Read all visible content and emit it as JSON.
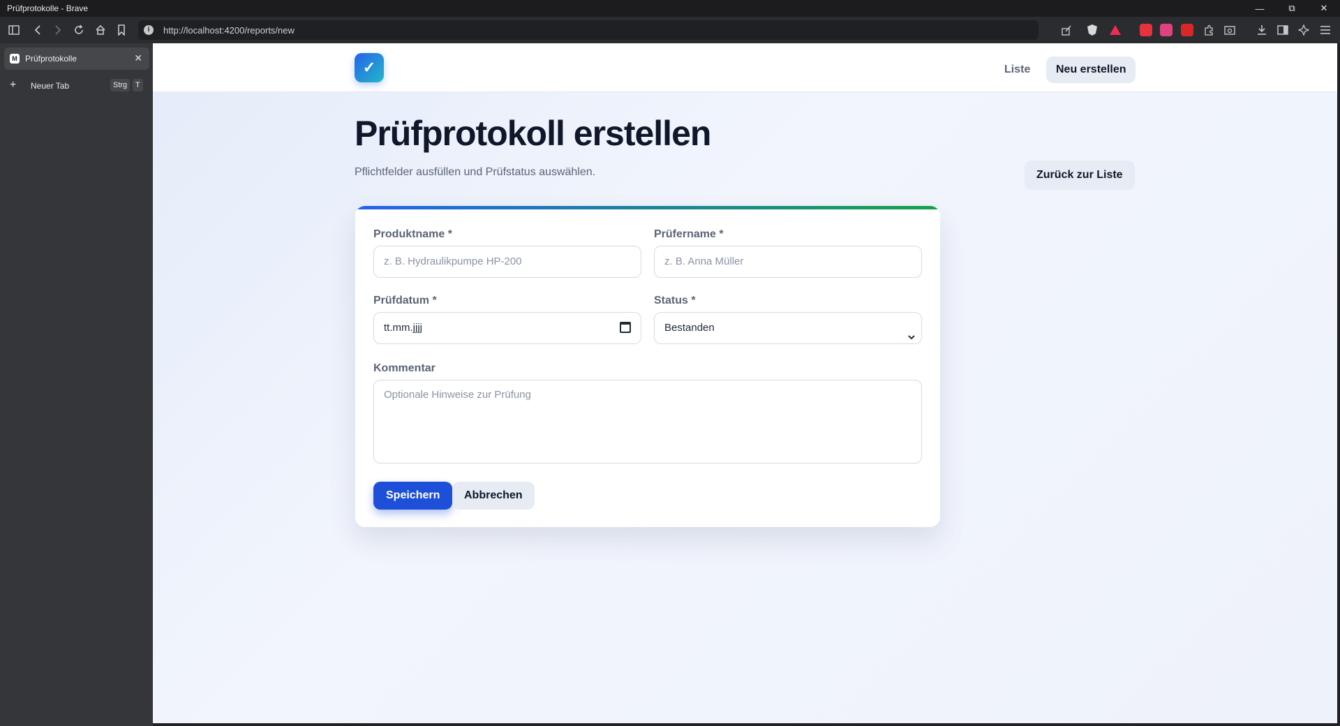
{
  "window": {
    "title": "Prüfprotokolle - Brave"
  },
  "toolbar": {
    "url": "http://localhost:4200/reports/new"
  },
  "sidebar": {
    "tabs": [
      {
        "label": "Prüfprotokolle",
        "favicon": "M"
      }
    ],
    "new_tab": {
      "label": "Neuer Tab",
      "shortcut_mod": "Strg",
      "shortcut_key": "T"
    }
  },
  "nav": {
    "logo": "✓",
    "liste": "Liste",
    "neu": "Neu erstellen"
  },
  "header": {
    "title": "Prüfprotokoll erstellen",
    "subtitle": "Pflichtfelder ausfüllen und Prüfstatus auswählen.",
    "back": "Zurück zur Liste"
  },
  "form": {
    "produktname": {
      "label": "Produktname *",
      "placeholder": "z. B. Hydraulikpumpe HP-200"
    },
    "pruefername": {
      "label": "Prüfername *",
      "placeholder": "z. B. Anna Müller"
    },
    "pruefdatum": {
      "label": "Prüfdatum *",
      "value": "tt.mm.jjjj"
    },
    "status": {
      "label": "Status *",
      "value": "Bestanden"
    },
    "kommentar": {
      "label": "Kommentar",
      "placeholder": "Optionale Hinweise zur Prüfung"
    },
    "save": "Speichern",
    "cancel": "Abbrechen"
  },
  "colors": {
    "accent": "#1d4fd8",
    "gradient_start": "#2563eb",
    "gradient_end": "#16a34a"
  }
}
